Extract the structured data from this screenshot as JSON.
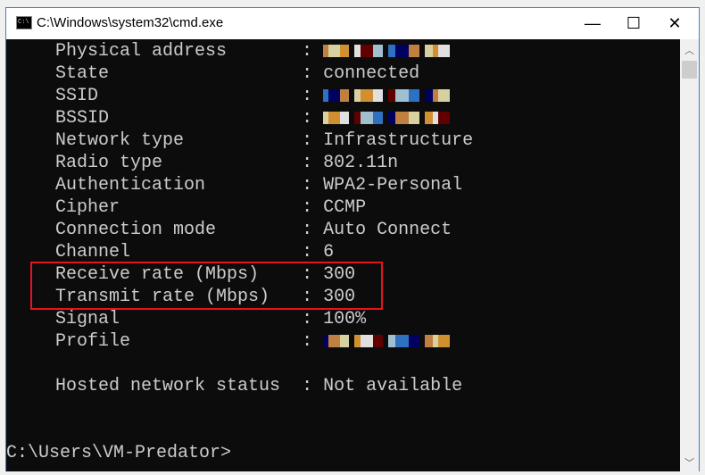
{
  "window": {
    "title": "C:\\Windows\\system32\\cmd.exe",
    "icon": "cmd-icon",
    "minimize": "—",
    "maximize": "☐",
    "close": "✕"
  },
  "console": {
    "lines": [
      {
        "key": "Physical address",
        "value": "",
        "redacted": true
      },
      {
        "key": "State",
        "value": "connected"
      },
      {
        "key": "SSID",
        "value": "",
        "redacted": true
      },
      {
        "key": "BSSID",
        "value": "",
        "redacted": true
      },
      {
        "key": "Network type",
        "value": "Infrastructure"
      },
      {
        "key": "Radio type",
        "value": "802.11n"
      },
      {
        "key": "Authentication",
        "value": "WPA2-Personal"
      },
      {
        "key": "Cipher",
        "value": "CCMP"
      },
      {
        "key": "Connection mode",
        "value": "Auto Connect"
      },
      {
        "key": "Channel",
        "value": "6"
      },
      {
        "key": "Receive rate (Mbps)",
        "value": "300"
      },
      {
        "key": "Transmit rate (Mbps)",
        "value": "300"
      },
      {
        "key": "Signal",
        "value": "100%"
      },
      {
        "key": "Profile",
        "value": "",
        "redacted": true
      },
      {
        "key": "Hosted network status",
        "value": "Not available",
        "gap": true
      }
    ],
    "prompt": "C:\\Users\\VM-Predator>"
  },
  "highlight_color": "#e8141c"
}
